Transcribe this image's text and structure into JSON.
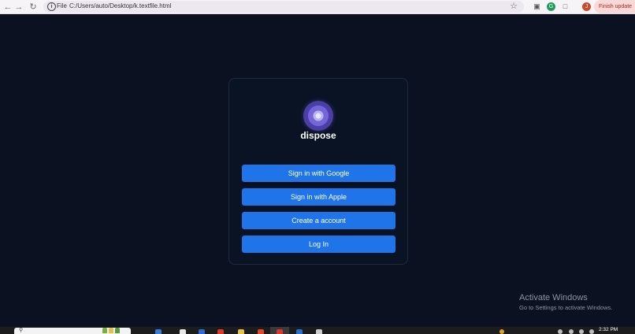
{
  "browser": {
    "back_icon": "arrow-left-icon",
    "forward_icon": "arrow-right-icon",
    "reload_icon": "reload-icon",
    "info_icon": "info-icon",
    "scheme_label": "File",
    "url": "C:/Users/auto/Desktop/k.textfile.html",
    "bookmark_icon": "star-icon",
    "finish_update_label": "Finish update"
  },
  "app": {
    "brand": "dispose",
    "logo_icon": "dispose-logo",
    "buttons": {
      "google": "Sign in with Google",
      "apple": "Sign in with Apple",
      "create": "Create a account",
      "login": "Log In"
    }
  },
  "watermark": {
    "title": "Activate Windows",
    "subtitle": "Go to Settings to activate Windows."
  },
  "taskbar": {
    "clock": "2:32 PM"
  },
  "colors": {
    "page_bg": "#0b1120",
    "card_bg": "#0a1324",
    "button_bg": "#1f74ea",
    "toolbar_bg": "#f7f4f8",
    "update_bg": "#f8d9d8",
    "update_text": "#b3261e"
  }
}
